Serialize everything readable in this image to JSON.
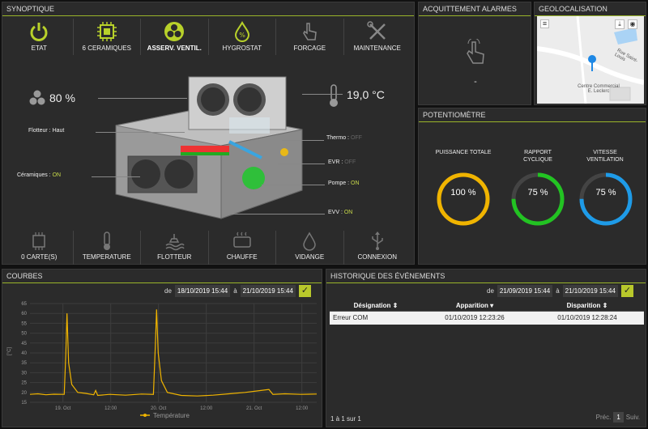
{
  "synoptique": {
    "title": "SYNOPTIQUE",
    "top_buttons": [
      {
        "label": "ETAT",
        "icon": "power-icon",
        "active": false
      },
      {
        "label": "6 CERAMIQUES",
        "icon": "chip-icon",
        "active": false
      },
      {
        "label": "ASSERV. VENTIL.",
        "icon": "fan-icon",
        "active": true
      },
      {
        "label": "HYGROSTAT",
        "icon": "humidity-drop-icon",
        "active": false
      },
      {
        "label": "FORCAGE",
        "icon": "hand-pointer-icon",
        "active": false
      },
      {
        "label": "MAINTENANCE",
        "icon": "tools-icon",
        "active": false
      }
    ],
    "bottom_buttons": [
      {
        "label": "0 CARTE(S)",
        "icon": "chip-icon"
      },
      {
        "label": "TEMPERATURE",
        "icon": "thermometer-icon"
      },
      {
        "label": "FLOTTEUR",
        "icon": "float-icon"
      },
      {
        "label": "CHAUFFE",
        "icon": "heater-icon"
      },
      {
        "label": "VIDANGE",
        "icon": "drop-icon"
      },
      {
        "label": "CONNEXION",
        "icon": "usb-icon"
      }
    ],
    "fan_speed": "80 %",
    "temperature": "19,0 °C",
    "flotteur_label": "Flotteur : Haut",
    "ceramiques_label": "Céramiques : ",
    "ceramiques_state": "ON",
    "thermo_label": "Thermo : ",
    "thermo_state": "OFF",
    "evr_label": "EVR : ",
    "evr_state": "OFF",
    "pompe_label": "Pompe : ",
    "pompe_state": "ON",
    "evv_label": "EVV : ",
    "evv_state": "ON"
  },
  "acquittement": {
    "title": "ACQUITTEMENT ALARMES",
    "value": "-"
  },
  "geolocalisation": {
    "title": "GEOLOCALISATION",
    "street": "Rue Saint-Louis",
    "place_line1": "Centre Commercial",
    "place_line2": "E. Leclerc"
  },
  "potentiometre": {
    "title": "POTENTIOMÈTRE",
    "gauges": [
      {
        "label": "PUISSANCE TOTALE",
        "value": "100 %",
        "percent": 100,
        "color": "#f0b400"
      },
      {
        "label": "RAPPORT CYCLIQUE",
        "value": "75 %",
        "percent": 75,
        "color": "#22c322"
      },
      {
        "label": "VITESSE VENTILATION",
        "value": "75 %",
        "percent": 75,
        "color": "#1e9be8"
      }
    ]
  },
  "courbes": {
    "title": "COURBES",
    "de_label": "de",
    "a_label": "à",
    "date_from": "18/10/2019 15:44",
    "date_to": "21/10/2019 15:44",
    "y_ticks": [
      "65",
      "60",
      "55",
      "50",
      "45",
      "40",
      "35",
      "30",
      "25",
      "20",
      "15"
    ],
    "y_axis_label": "[°C]",
    "x_ticks": [
      "19. Oct",
      "12:00",
      "20. Oct",
      "12:00",
      "21. Oct",
      "12:00"
    ],
    "legend": "Température",
    "series_color": "#f0b400"
  },
  "historique": {
    "title": "HISTORIQUE DES ÉVÉNEMENTS",
    "de_label": "de",
    "a_label": "à",
    "date_from": "21/09/2019 15:44",
    "date_to": "21/10/2019 15:44",
    "columns": [
      "Désignation",
      "Apparition",
      "Disparition"
    ],
    "rows": [
      {
        "designation": "Erreur COM",
        "apparition": "01/10/2019 12:23:26",
        "disparition": "01/10/2019 12:28:24"
      }
    ],
    "footer": "1 à 1 sur 1",
    "prev": "Préc.",
    "page": "1",
    "next": "Suiv."
  }
}
